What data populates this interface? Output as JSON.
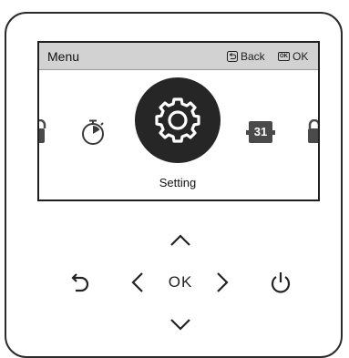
{
  "screen": {
    "title": "Menu",
    "back_hint": "Back",
    "ok_hint": "OK",
    "ok_icon_text": "OK"
  },
  "carousel": {
    "selected_label": "Setting",
    "items": [
      "lock",
      "timer",
      "setting",
      "calendar",
      "lock"
    ],
    "calendar_day": "31"
  },
  "controls": {
    "ok_label": "OK"
  }
}
